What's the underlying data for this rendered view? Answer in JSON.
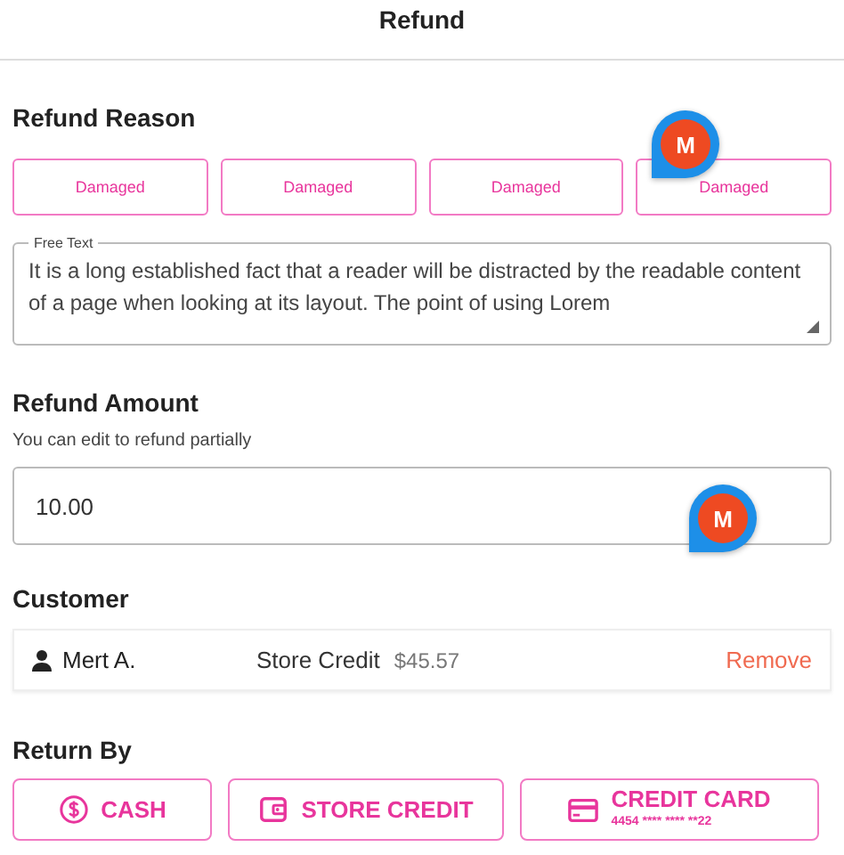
{
  "header": {
    "title": "Refund"
  },
  "refund_reason": {
    "heading": "Refund Reason",
    "reasons": [
      {
        "label": "Damaged"
      },
      {
        "label": "Damaged"
      },
      {
        "label": "Damaged"
      },
      {
        "label": "Damaged"
      }
    ],
    "free_text": {
      "label": "Free Text",
      "value": "It is a long established fact that a reader will be distracted by the readable content of a page when looking at its layout. The point of using Lorem"
    }
  },
  "refund_amount": {
    "heading": "Refund Amount",
    "hint": "You can edit to refund partially",
    "value": "10.00"
  },
  "customer": {
    "heading": "Customer",
    "name": "Mert A.",
    "credit_label": "Store Credit",
    "credit_amount": "$45.57",
    "action": "Remove"
  },
  "return_by": {
    "heading": "Return By",
    "options": [
      {
        "kind": "cash",
        "label": "CASH"
      },
      {
        "kind": "store_credit",
        "label": "STORE CREDIT"
      },
      {
        "kind": "card",
        "label": "CREDIT CARD",
        "detail": "4454 **** **** **22"
      }
    ]
  },
  "markers": [
    {
      "label": "M"
    },
    {
      "label": "M"
    }
  ]
}
